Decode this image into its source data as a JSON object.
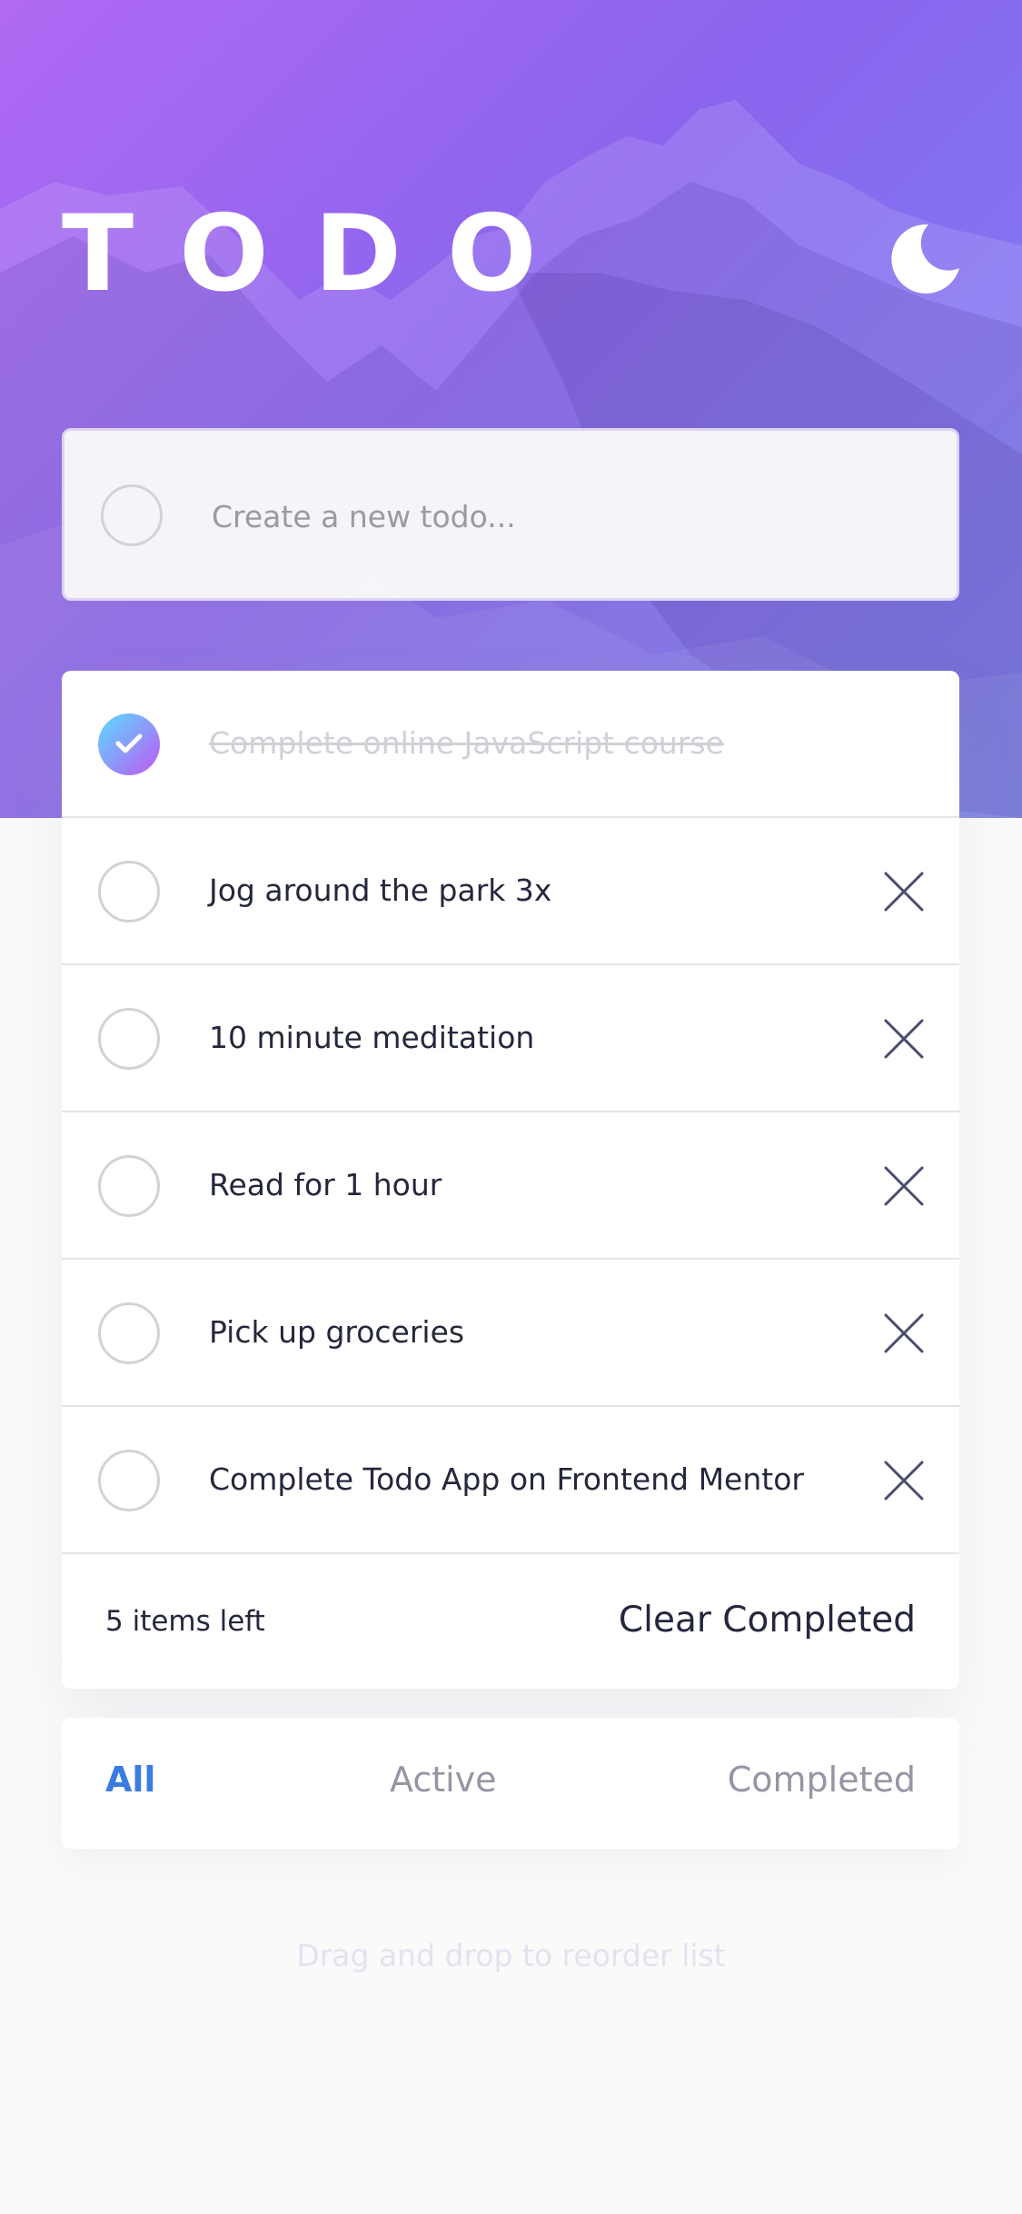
{
  "header": {
    "title": "TODO",
    "theme_toggle_icon": "moon-icon"
  },
  "new_todo": {
    "placeholder": "Create a new todo..."
  },
  "todos": [
    {
      "text": "Complete online JavaScript course",
      "completed": true
    },
    {
      "text": "Jog around the park 3x",
      "completed": false
    },
    {
      "text": "10 minute meditation",
      "completed": false
    },
    {
      "text": "Read for 1 hour",
      "completed": false
    },
    {
      "text": "Pick up groceries",
      "completed": false
    },
    {
      "text": "Complete Todo App on Frontend Mentor",
      "completed": false
    }
  ],
  "footer": {
    "items_left": "5 items left",
    "clear_label": "Clear Completed"
  },
  "filters": {
    "all": "All",
    "active": "Active",
    "completed": "Completed",
    "selected": "All"
  },
  "hint": "Drag and drop to reorder list",
  "colors": {
    "accent": "#3a7ce2",
    "check_gradient_start": "#57ddff",
    "check_gradient_end": "#c058f3",
    "hero_start": "#b069f2",
    "hero_end": "#7b86f4"
  }
}
